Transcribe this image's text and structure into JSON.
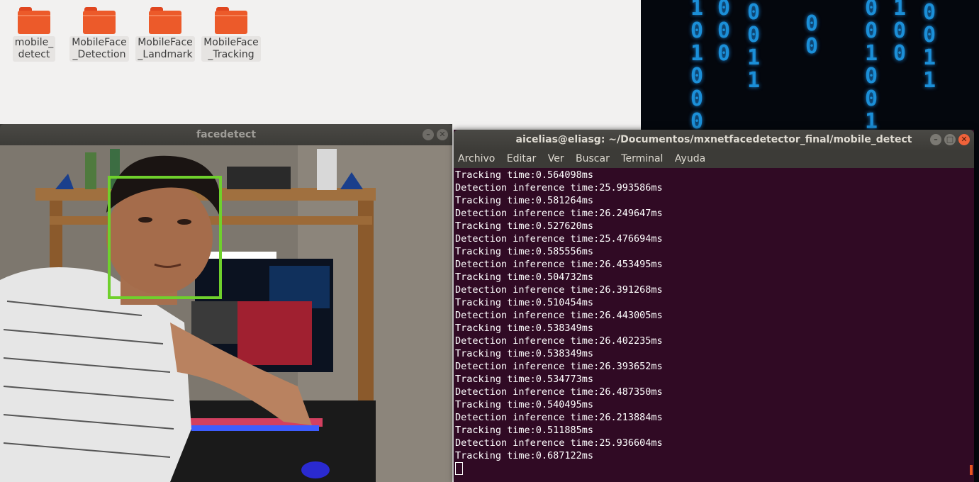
{
  "desktop": {
    "icons": [
      {
        "label": "mobile_\ndetect"
      },
      {
        "label": "MobileFace\n_Detection"
      },
      {
        "label": "MobileFace\n_Landmark"
      },
      {
        "label": "MobileFace\n_Tracking"
      }
    ],
    "wallpaper_columns": [
      "1\n0\n1\n0\n0\n0",
      "0\n0\n0",
      "0\n0\n1\n1",
      "0\n0",
      "0\n0\n1\n0\n0\n1",
      "1\n0\n0",
      "0\n0\n1\n1"
    ]
  },
  "facedetect_window": {
    "title": "facedetect",
    "face_box_color": "#6fd02c"
  },
  "terminal": {
    "title": "aicelias@eliasg: ~/Documentos/mxnetfacedetector_final/mobile_detect",
    "menu": [
      "Archivo",
      "Editar",
      "Ver",
      "Buscar",
      "Terminal",
      "Ayuda"
    ],
    "lines": [
      "Tracking time:0.564098ms",
      "Detection inference time:25.993586ms",
      "Tracking time:0.581264ms",
      "Detection inference time:26.249647ms",
      "Tracking time:0.527620ms",
      "Detection inference time:25.476694ms",
      "Tracking time:0.585556ms",
      "Detection inference time:26.453495ms",
      "Tracking time:0.504732ms",
      "Detection inference time:26.391268ms",
      "Tracking time:0.510454ms",
      "Detection inference time:26.443005ms",
      "Tracking time:0.538349ms",
      "Detection inference time:26.402235ms",
      "Tracking time:0.538349ms",
      "Detection inference time:26.393652ms",
      "Tracking time:0.534773ms",
      "Detection inference time:26.487350ms",
      "Tracking time:0.540495ms",
      "Detection inference time:26.213884ms",
      "Tracking time:0.511885ms",
      "Detection inference time:25.936604ms",
      "Tracking time:0.687122ms"
    ],
    "background": "#300a24"
  }
}
